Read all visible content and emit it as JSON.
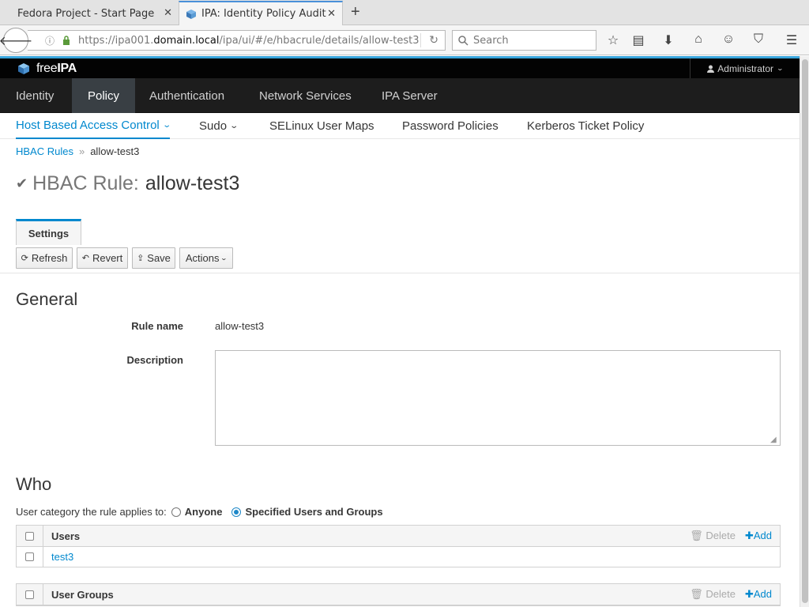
{
  "browser": {
    "tabs": [
      {
        "title": "Fedora Project - Start Page",
        "close": "✕"
      },
      {
        "title": "IPA: Identity Policy Audit",
        "close": "✕"
      }
    ],
    "new_tab": "+",
    "url_prefix": "https://ipa001.",
    "url_domain": "domain.local",
    "url_path": "/ipa/ui/#/e/hbacrule/details/allow-test3",
    "search_placeholder": "Search"
  },
  "masthead": {
    "brand_light": "free",
    "brand_bold": "IPA",
    "user": "Administrator"
  },
  "primary_nav": [
    "Identity",
    "Policy",
    "Authentication",
    "Network Services",
    "IPA Server"
  ],
  "secondary_nav": [
    "Host Based Access Control",
    "Sudo",
    "SELinux User Maps",
    "Password Policies",
    "Kerberos Ticket Policy"
  ],
  "breadcrumb": {
    "parent": "HBAC Rules",
    "current": "allow-test3"
  },
  "title": {
    "type": "HBAC Rule:",
    "name": "allow-test3"
  },
  "facet_tab": "Settings",
  "toolbar": {
    "refresh": "Refresh",
    "revert": "Revert",
    "save": "Save",
    "actions": "Actions"
  },
  "general": {
    "heading": "General",
    "rule_name_label": "Rule name",
    "rule_name_value": "allow-test3",
    "description_label": "Description",
    "description_value": ""
  },
  "who": {
    "heading": "Who",
    "category_label": "User category the rule applies to:",
    "option_anyone": "Anyone",
    "option_specified": "Specified Users and Groups",
    "selected": "Specified Users and Groups",
    "users_table": {
      "header": "Users",
      "delete": "Delete",
      "add": "Add",
      "rows": [
        "test3"
      ]
    },
    "groups_table": {
      "header": "User Groups",
      "delete": "Delete",
      "add": "Add",
      "rows": []
    }
  }
}
